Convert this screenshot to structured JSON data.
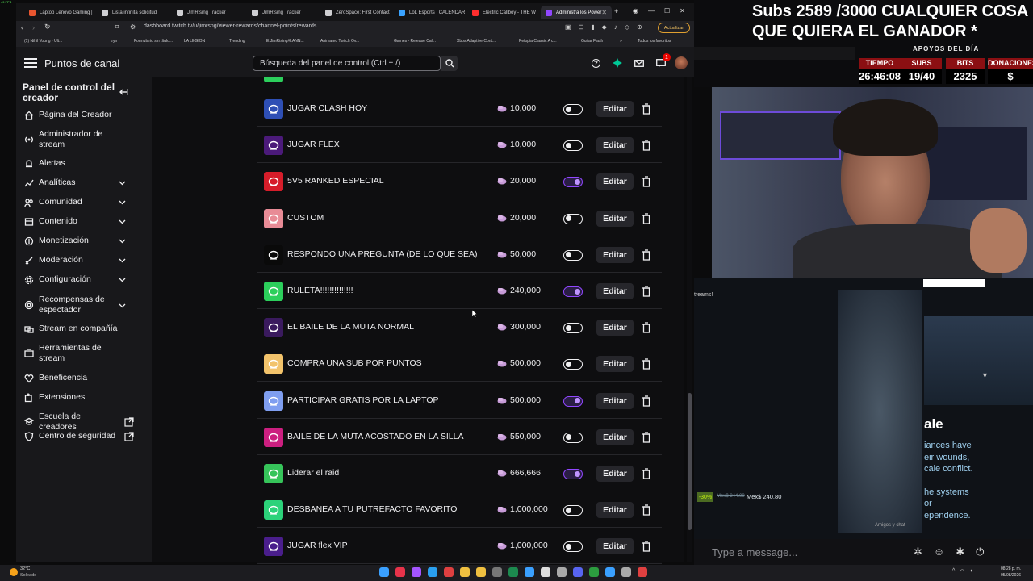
{
  "browser": {
    "tabs": [
      {
        "label": "Laptop Lenovo Gaming |",
        "color": "#e8552f"
      },
      {
        "label": "Lista infinita solicitud",
        "color": "#cfcfd2"
      },
      {
        "label": "JimRising Tracker",
        "color": "#cfcfd2"
      },
      {
        "label": "JimRising Tracker",
        "color": "#cfcfd2"
      },
      {
        "label": "ZeroSpace: First Contact",
        "color": "#cfcfd2"
      },
      {
        "label": "LoL Esports | CALENDAR",
        "color": "#3aa3ff"
      },
      {
        "label": "Electric Callboy - THE W",
        "color": "#ff2e2e"
      },
      {
        "label": "Administra los Power",
        "color": "#9147ff"
      }
    ],
    "url": "dashboard.twitch.tv/u/jimrsng/viewer-rewards/channel-points/rewards",
    "update_label": "Actualizar",
    "bookmarks": [
      "(1) Nihil Young - Ult...",
      "tryn",
      "Formulario sin título...",
      "LA LEGION",
      "Trending",
      "E.JimRising#LANN...",
      "Animated Twitch Ov...",
      "Games - Release Cal...",
      "Xbox Adaptive Cont...",
      "Petopia Classic A c...",
      "Guitar Flash",
      "»",
      "Todos los favoritos"
    ]
  },
  "header": {
    "title": "Puntos de canal",
    "search_placeholder": "Búsqueda del panel de control (Ctrl + /)",
    "notif_count": "1"
  },
  "sidebar": {
    "title": "Panel de control del creador",
    "items": [
      {
        "label": "Página del Creador",
        "icon": "home-icon",
        "chev": false,
        "ext": false
      },
      {
        "label": "Administrador de stream",
        "icon": "broadcast-icon",
        "chev": false,
        "ext": false
      },
      {
        "label": "Alertas",
        "icon": "bell-icon",
        "chev": false,
        "ext": false
      },
      {
        "label": "Analíticas",
        "icon": "chart-icon",
        "chev": true,
        "ext": false
      },
      {
        "label": "Comunidad",
        "icon": "community-icon",
        "chev": true,
        "ext": false
      },
      {
        "label": "Contenido",
        "icon": "content-icon",
        "chev": true,
        "ext": false
      },
      {
        "label": "Monetización",
        "icon": "money-icon",
        "chev": true,
        "ext": false
      },
      {
        "label": "Moderación",
        "icon": "sword-icon",
        "chev": true,
        "ext": false
      },
      {
        "label": "Configuración",
        "icon": "gear-icon",
        "chev": true,
        "ext": false
      },
      {
        "label": "Recompensas de espectador",
        "icon": "reward-icon",
        "chev": true,
        "ext": false
      },
      {
        "label": "Stream en compañía",
        "icon": "together-icon",
        "chev": false,
        "ext": false
      },
      {
        "label": "Herramientas de stream",
        "icon": "tools-icon",
        "chev": false,
        "ext": false
      },
      {
        "label": "Beneficencia",
        "icon": "heart-icon",
        "chev": false,
        "ext": false
      },
      {
        "label": "Extensiones",
        "icon": "puzzle-icon",
        "chev": false,
        "ext": false
      },
      {
        "label": "Escuela de creadores",
        "icon": "school-icon",
        "chev": false,
        "ext": true
      },
      {
        "label": "Centro de seguridad",
        "icon": "shield-icon",
        "chev": false,
        "ext": true
      }
    ]
  },
  "rewards": [
    {
      "title": "JUGAR CLASH HOY",
      "cost": "10,000",
      "enabled": false,
      "color": "#2e4fb5",
      "edit": "Editar"
    },
    {
      "title": "JUGAR FLEX",
      "cost": "10,000",
      "enabled": false,
      "color": "#4b1a7a",
      "edit": "Editar"
    },
    {
      "title": "5V5 RANKED ESPECIAL",
      "cost": "20,000",
      "enabled": true,
      "color": "#d61d2a",
      "edit": "Editar"
    },
    {
      "title": "CUSTOM",
      "cost": "20,000",
      "enabled": false,
      "color": "#e88b96",
      "edit": "Editar"
    },
    {
      "title": "RESPONDO UNA PREGUNTA (DE LO QUE SEA)",
      "cost": "50,000",
      "enabled": false,
      "color": "#0a0a0a",
      "edit": "Editar"
    },
    {
      "title": "RULETA!!!!!!!!!!!!!!",
      "cost": "240,000",
      "enabled": true,
      "color": "#2ccf5c",
      "edit": "Editar"
    },
    {
      "title": "EL BAILE DE LA MUTA NORMAL",
      "cost": "300,000",
      "enabled": false,
      "color": "#3a1a5e",
      "edit": "Editar"
    },
    {
      "title": "COMPRA UNA SUB POR PUNTOS",
      "cost": "500,000",
      "enabled": false,
      "color": "#f2c36b",
      "edit": "Editar"
    },
    {
      "title": "PARTICIPAR GRATIS POR LA LAPTOP",
      "cost": "500,000",
      "enabled": true,
      "color": "#7f9ef0",
      "edit": "Editar"
    },
    {
      "title": "BAILE DE LA MUTA ACOSTADO EN LA SILLA",
      "cost": "550,000",
      "enabled": false,
      "color": "#cc1f80",
      "edit": "Editar"
    },
    {
      "title": "Liderar el raid",
      "cost": "666,666",
      "enabled": true,
      "color": "#36c45a",
      "edit": "Editar"
    },
    {
      "title": "DESBANEA A TU PUTREFACTO FAVORITO",
      "cost": "1,000,000",
      "enabled": false,
      "color": "#2cd27a",
      "edit": "Editar"
    },
    {
      "title": "JUGAR flex VIP",
      "cost": "1,000,000",
      "enabled": false,
      "color": "#4a1e8c",
      "edit": "Editar"
    }
  ],
  "stream": {
    "subs_banner": "Subs 2589 /3000 CUALQUIER COSA QUE QUIERA EL GANADOR *",
    "apoyos": "APOYOS DEL DÍA",
    "stat_labels": [
      "TIEMPO",
      "SUBS",
      "BITS",
      "DONACIONES"
    ],
    "stat_values": [
      "26:46:08",
      "19/40",
      "2325",
      "$"
    ],
    "streams_text": "treams!",
    "game_lines": [
      "ale",
      "iances have",
      "eir wounds,",
      "cale conflict.",
      "he systems",
      "or",
      "ependence."
    ],
    "discount": "-30%",
    "old_price": "Mex$ 344.00",
    "price": "Mex$ 240.80",
    "friends": "Amigos y chat",
    "chat_placeholder": "Type a message...",
    "fps": "49 FPS"
  },
  "taskbar": {
    "weather_temp": "32°C",
    "weather_desc": "Soleado",
    "time": "08:28 p. m.",
    "date": "05/08/2026"
  }
}
